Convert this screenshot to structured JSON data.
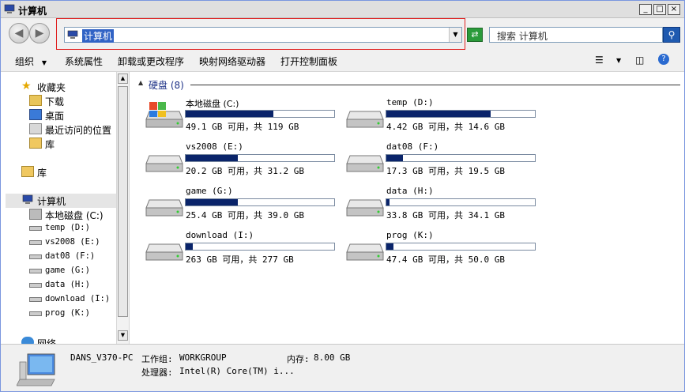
{
  "window": {
    "title": "计算机",
    "minimize": "_",
    "restore": "□",
    "close": "×"
  },
  "address": {
    "path": "计算机",
    "search_placeholder": "搜索 计算机"
  },
  "toolbar": {
    "organize": "组织",
    "system_properties": "系统属性",
    "uninstall": "卸载或更改程序",
    "map_drive": "映射网络驱动器",
    "control_panel": "打开控制面板"
  },
  "sidebar": {
    "favorites": "收藏夹",
    "downloads": "下载",
    "desktop": "桌面",
    "recent": "最近访问的位置",
    "libraries_fav": "库",
    "libraries": "库",
    "computer": "计算机",
    "drives": [
      "本地磁盘 (C:)",
      "temp (D:)",
      "vs2008 (E:)",
      "dat08 (F:)",
      "game (G:)",
      "data (H:)",
      "download (I:)",
      "prog (K:)"
    ],
    "network": "网络"
  },
  "group": {
    "label": "硬盘 (8)"
  },
  "drives": [
    {
      "name": "本地磁盘 (C:)",
      "free": "49.1 GB 可用，共 119 GB",
      "used_fraction": 0.59,
      "system": true
    },
    {
      "name": "temp (D:)",
      "free": "4.42 GB 可用，共 14.6 GB",
      "used_fraction": 0.7,
      "system": false
    },
    {
      "name": "vs2008 (E:)",
      "free": "20.2 GB 可用，共 31.2 GB",
      "used_fraction": 0.35,
      "system": false
    },
    {
      "name": "dat08 (F:)",
      "free": "17.3 GB 可用，共 19.5 GB",
      "used_fraction": 0.11,
      "system": false
    },
    {
      "name": "game (G:)",
      "free": "25.4 GB 可用，共 39.0 GB",
      "used_fraction": 0.35,
      "system": false
    },
    {
      "name": "data (H:)",
      "free": "33.8 GB 可用，共 34.1 GB",
      "used_fraction": 0.01,
      "system": false
    },
    {
      "name": "download (I:)",
      "free": "263 GB 可用，共 277 GB",
      "used_fraction": 0.05,
      "system": false
    },
    {
      "name": "prog (K:)",
      "free": "47.4 GB 可用，共 50.0 GB",
      "used_fraction": 0.05,
      "system": false
    }
  ],
  "details": {
    "pc_name": "DANS_V370-PC",
    "workgroup_label": "工作组:",
    "workgroup": "WORKGROUP",
    "memory_label": "内存:",
    "memory": "8.00 GB",
    "cpu_label": "处理器:",
    "cpu": "Intel(R) Core(TM) i..."
  }
}
